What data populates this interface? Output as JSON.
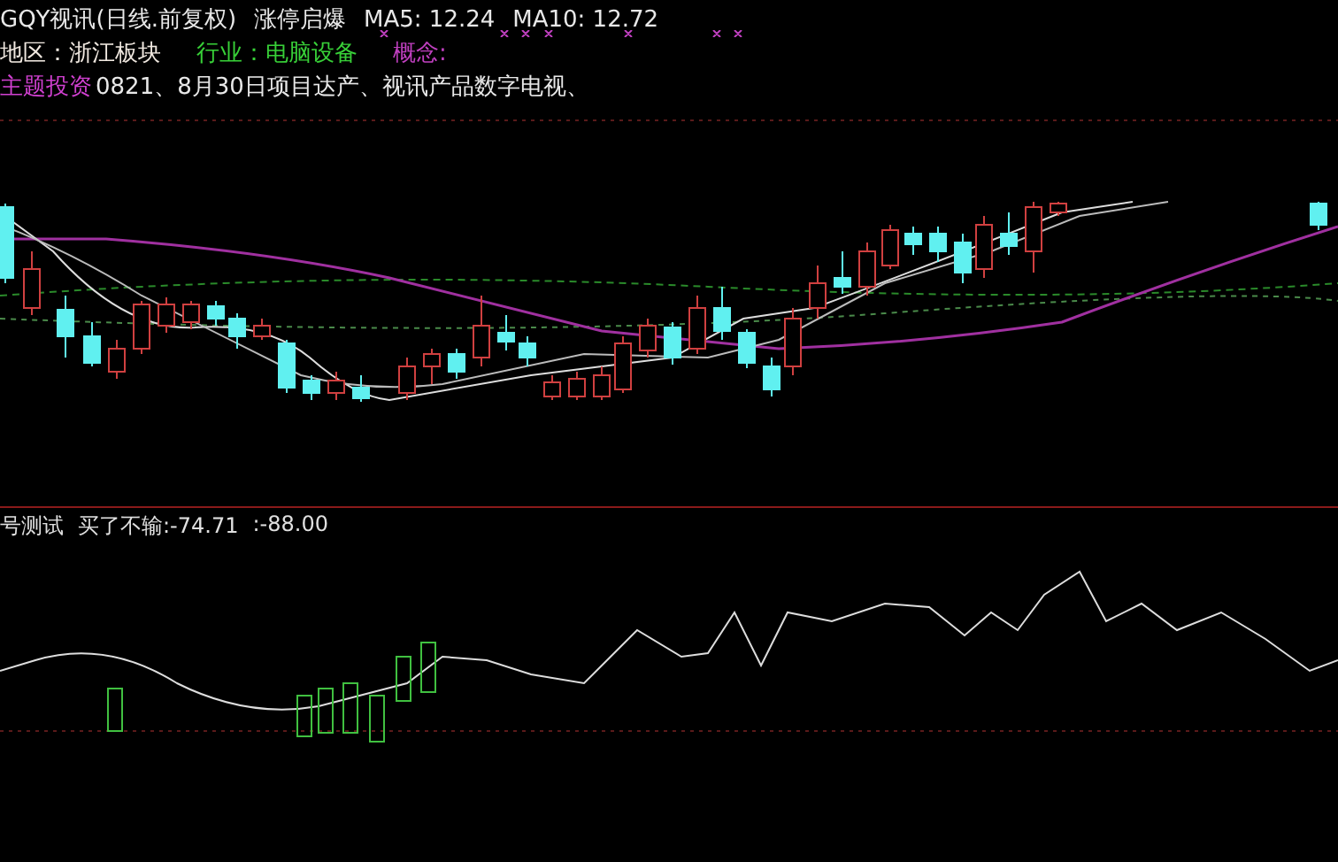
{
  "header": {
    "title": "GQY视讯(日线.前复权)",
    "signal": "涨停启爆",
    "ma5": "MA5: 12.24",
    "ma10": "MA10: 12.72"
  },
  "info": [
    {
      "kind": "region",
      "text": "地区：浙江板块"
    },
    {
      "kind": "industry",
      "text": "行业：电脑设备"
    },
    {
      "kind": "concept",
      "text": "概念:"
    }
  ],
  "theme": {
    "label": "主题投资",
    "text": "0821、8月30日项目达产、视讯产品数字电视、"
  },
  "indicator": {
    "name": "号测试",
    "value1": "买了不输:-74.71",
    "value2": ":-88.00"
  }
}
